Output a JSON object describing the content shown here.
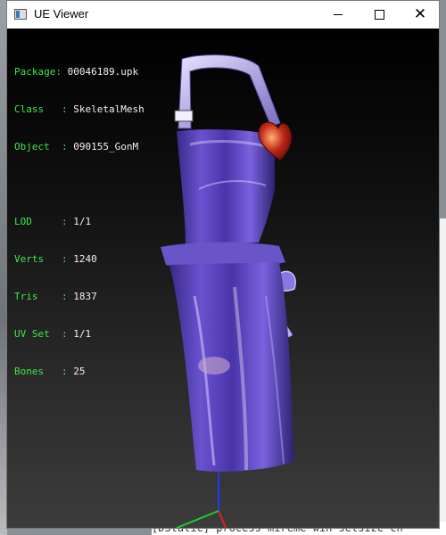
{
  "window": {
    "title": "UE Viewer",
    "minimize_symbol": "",
    "close_symbol": "✕"
  },
  "info": {
    "package_label": "Package: ",
    "package_value": "00046189.upk",
    "class_label": "Class   : ",
    "class_value": "SkeletalMesh",
    "object_label": "Object  : ",
    "object_value": "090155_GonM",
    "lod_label": "LOD     : ",
    "lod_value": "1/1",
    "verts_label": "Verts   : ",
    "verts_value": "1240",
    "tris_label": "Tris    : ",
    "tris_value": "1837",
    "uvset_label": "UV Set  : ",
    "uvset_value": "1/1",
    "bones_label": "Bones   : ",
    "bones_value": "25"
  },
  "background_console": {
    "bottom_text": "[DStatic] process  mireme win setsize  cn"
  },
  "colors": {
    "info_key": "#3ee84a",
    "info_value": "#f2f2f2",
    "apron_main": "#5b3fb8",
    "apron_highlight": "#c9b8ff",
    "axis_blue": "#1e3cff",
    "axis_green": "#1bd12a",
    "axis_red": "#e02020"
  }
}
